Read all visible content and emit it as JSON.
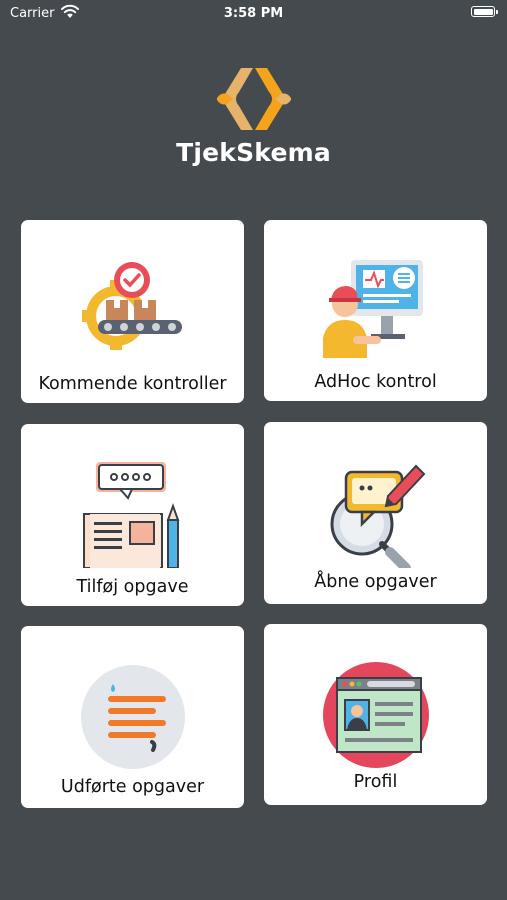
{
  "status_bar": {
    "carrier": "Carrier",
    "time": "3:58 PM"
  },
  "brand": {
    "app_name": "TjekSkema"
  },
  "tiles": [
    {
      "label": "Kommende kontroller",
      "icon": "conveyor-gear-icon"
    },
    {
      "label": "AdHoc kontrol",
      "icon": "technician-monitor-icon"
    },
    {
      "label": "Tilføj opgave",
      "icon": "document-pen-icon"
    },
    {
      "label": "Åbne opgaver",
      "icon": "search-chat-icon"
    },
    {
      "label": "Udførte opgaver",
      "icon": "list-circle-icon"
    },
    {
      "label": "Profil",
      "icon": "profile-browser-icon"
    }
  ],
  "colors": {
    "background": "#454a4f",
    "brand_orange": "#f5a31a",
    "brand_tan": "#e6b36a"
  }
}
